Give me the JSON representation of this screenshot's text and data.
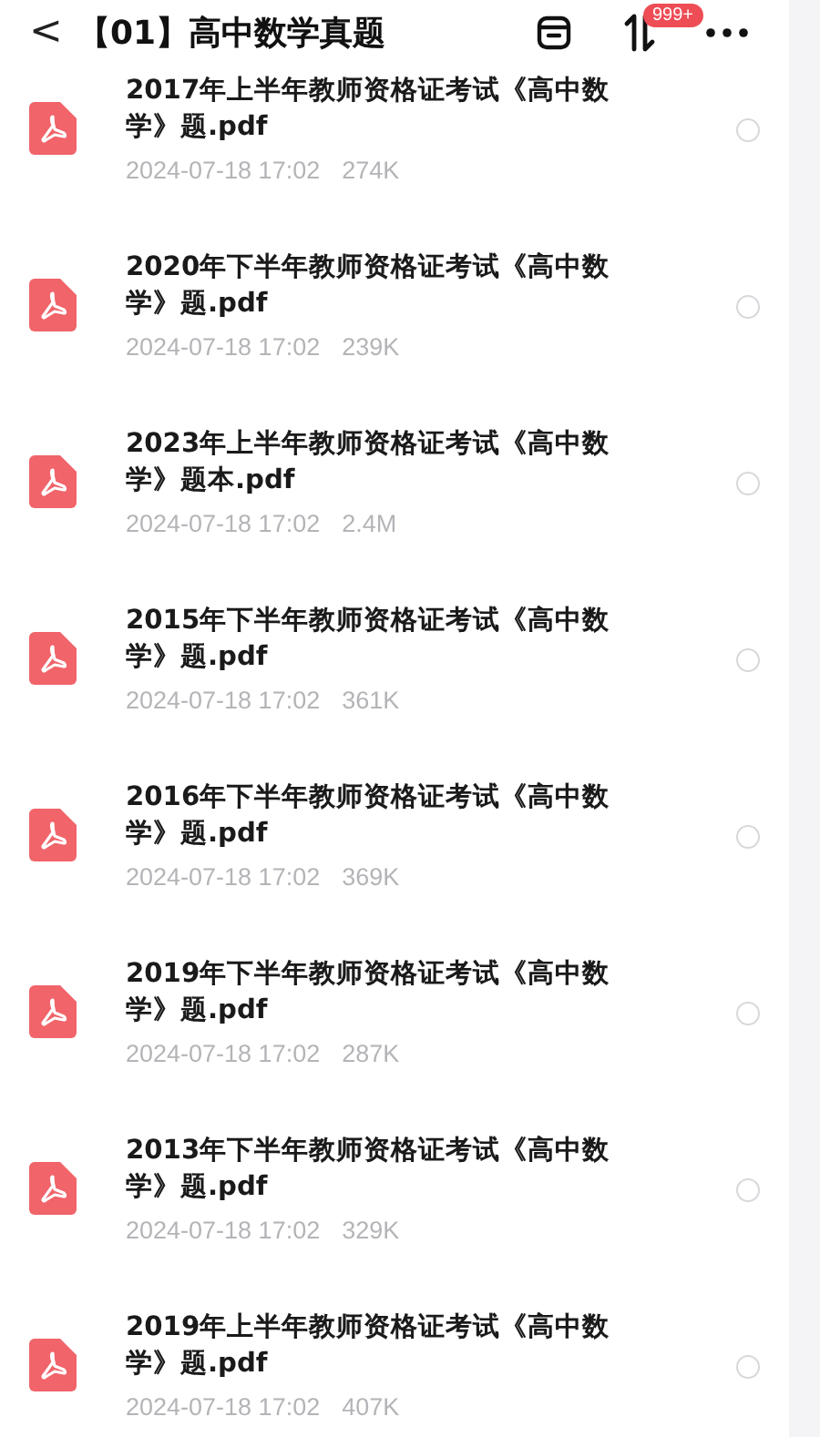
{
  "header": {
    "back": "<",
    "title": "【01】高中数学真题",
    "badge": "999+"
  },
  "files": [
    {
      "name": "2017年上半年教师资格证考试《高中数学》题.pdf",
      "date": "2024-07-18 17:02",
      "size": "274K",
      "selected": false
    },
    {
      "name": "2020年下半年教师资格证考试《高中数学》题.pdf",
      "date": "2024-07-18 17:02",
      "size": "239K",
      "selected": false
    },
    {
      "name": "2023年上半年教师资格证考试《高中数学》题本.pdf",
      "date": "2024-07-18 17:02",
      "size": "2.4M",
      "selected": false
    },
    {
      "name": "2015年下半年教师资格证考试《高中数学》题.pdf",
      "date": "2024-07-18 17:02",
      "size": "361K",
      "selected": false
    },
    {
      "name": "2016年下半年教师资格证考试《高中数学》题.pdf",
      "date": "2024-07-18 17:02",
      "size": "369K",
      "selected": false
    },
    {
      "name": "2019年下半年教师资格证考试《高中数学》题.pdf",
      "date": "2024-07-18 17:02",
      "size": "287K",
      "selected": false
    },
    {
      "name": "2013年下半年教师资格证考试《高中数学》题.pdf",
      "date": "2024-07-18 17:02",
      "size": "329K",
      "selected": false
    },
    {
      "name": "2019年上半年教师资格证考试《高中数学》题.pdf",
      "date": "2024-07-18 17:02",
      "size": "407K",
      "selected": false
    }
  ]
}
